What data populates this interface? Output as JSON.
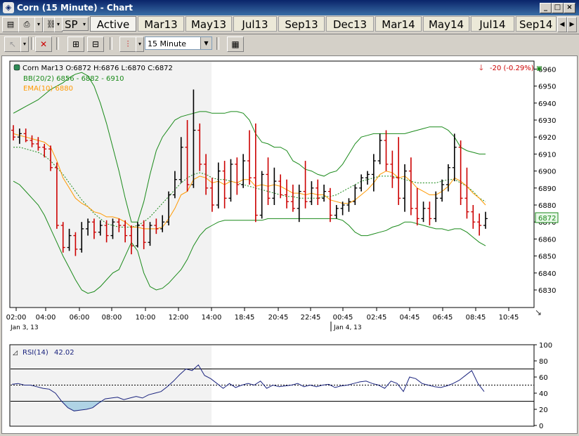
{
  "window": {
    "title": "Corn (15 Minute) - Chart"
  },
  "tabbar": {
    "symbol": "SP",
    "tabs": [
      "Active",
      "Mar13",
      "May13",
      "Jul13",
      "Sep13",
      "Dec13",
      "Mar14",
      "May14",
      "Jul14",
      "Sep14"
    ]
  },
  "toolbar": {
    "interval": "15 Minute"
  },
  "price_panel": {
    "ohlc": "Corn Mar13 O:6872 H:6876 L:6870 C:6872",
    "bb_label": "BB(20/2) 6856 - 6882 - 6910",
    "ema_label": "EMA(10) 6880",
    "change": "-20 (-0.29%)",
    "last": "6872",
    "bb_color": "#1a8a1a",
    "ema_color": "#ff9900",
    "up_color": "#000000",
    "down_color": "#cc0000"
  },
  "time_axis": {
    "ticks": [
      "02:00",
      "04:00",
      "06:00",
      "08:00",
      "10:00",
      "12:00",
      "14:00",
      "18:45",
      "20:45",
      "22:45",
      "00:45",
      "02:45",
      "04:45",
      "06:45",
      "08:45",
      "10:45"
    ],
    "dates": [
      "Jan 3, 13",
      "Jan 4, 13"
    ]
  },
  "rsi_panel": {
    "label": "RSI(14)",
    "value": "42.02"
  },
  "chart_data": [
    {
      "type": "candlestick",
      "title": "Corn Mar13",
      "y_ticks": [
        6830,
        6840,
        6850,
        6860,
        6870,
        6880,
        6890,
        6900,
        6910,
        6920,
        6930,
        6940,
        6950,
        6960
      ],
      "ylim": [
        6823,
        6967
      ],
      "bar_count": 77,
      "bars": [
        {
          "o": 6924,
          "h": 6927,
          "l": 6918,
          "c": 6920
        },
        {
          "o": 6920,
          "h": 6925,
          "l": 6916,
          "c": 6922
        },
        {
          "o": 6922,
          "h": 6925,
          "l": 6917,
          "c": 6918
        },
        {
          "o": 6918,
          "h": 6921,
          "l": 6914,
          "c": 6916
        },
        {
          "o": 6916,
          "h": 6920,
          "l": 6912,
          "c": 6914
        },
        {
          "o": 6914,
          "h": 6916,
          "l": 6908,
          "c": 6913
        },
        {
          "o": 6913,
          "h": 6915,
          "l": 6900,
          "c": 6902
        },
        {
          "o": 6902,
          "h": 6905,
          "l": 6866,
          "c": 6868
        },
        {
          "o": 6868,
          "h": 6870,
          "l": 6852,
          "c": 6855
        },
        {
          "o": 6855,
          "h": 6866,
          "l": 6853,
          "c": 6862
        },
        {
          "o": 6862,
          "h": 6864,
          "l": 6850,
          "c": 6854
        },
        {
          "o": 6854,
          "h": 6870,
          "l": 6852,
          "c": 6866
        },
        {
          "o": 6866,
          "h": 6872,
          "l": 6862,
          "c": 6870
        },
        {
          "o": 6870,
          "h": 6872,
          "l": 6860,
          "c": 6864
        },
        {
          "o": 6864,
          "h": 6871,
          "l": 6862,
          "c": 6868
        },
        {
          "o": 6868,
          "h": 6871,
          "l": 6858,
          "c": 6862
        },
        {
          "o": 6862,
          "h": 6872,
          "l": 6860,
          "c": 6870
        },
        {
          "o": 6870,
          "h": 6872,
          "l": 6864,
          "c": 6868
        },
        {
          "o": 6868,
          "h": 6871,
          "l": 6858,
          "c": 6862
        },
        {
          "o": 6862,
          "h": 6868,
          "l": 6851,
          "c": 6856
        },
        {
          "o": 6856,
          "h": 6870,
          "l": 6855,
          "c": 6868
        },
        {
          "o": 6868,
          "h": 6871,
          "l": 6854,
          "c": 6858
        },
        {
          "o": 6858,
          "h": 6870,
          "l": 6856,
          "c": 6868
        },
        {
          "o": 6868,
          "h": 6872,
          "l": 6863,
          "c": 6866
        },
        {
          "o": 6866,
          "h": 6874,
          "l": 6864,
          "c": 6870
        },
        {
          "o": 6870,
          "h": 6888,
          "l": 6868,
          "c": 6886
        },
        {
          "o": 6886,
          "h": 6900,
          "l": 6884,
          "c": 6895
        },
        {
          "o": 6895,
          "h": 6920,
          "l": 6893,
          "c": 6914
        },
        {
          "o": 6914,
          "h": 6930,
          "l": 6888,
          "c": 6892
        },
        {
          "o": 6892,
          "h": 6948,
          "l": 6890,
          "c": 6924
        },
        {
          "o": 6924,
          "h": 6928,
          "l": 6900,
          "c": 6904
        },
        {
          "o": 6904,
          "h": 6910,
          "l": 6886,
          "c": 6890
        },
        {
          "o": 6890,
          "h": 6896,
          "l": 6876,
          "c": 6880
        },
        {
          "o": 6880,
          "h": 6905,
          "l": 6878,
          "c": 6900
        },
        {
          "o": 6900,
          "h": 6906,
          "l": 6878,
          "c": 6884
        },
        {
          "o": 6884,
          "h": 6907,
          "l": 6882,
          "c": 6904
        },
        {
          "o": 6904,
          "h": 6908,
          "l": 6886,
          "c": 6892
        },
        {
          "o": 6892,
          "h": 6910,
          "l": 6890,
          "c": 6906
        },
        {
          "o": 6906,
          "h": 6924,
          "l": 6892,
          "c": 6896
        },
        {
          "o": 6896,
          "h": 6928,
          "l": 6870,
          "c": 6874
        },
        {
          "o": 6874,
          "h": 6900,
          "l": 6872,
          "c": 6898
        },
        {
          "o": 6898,
          "h": 6908,
          "l": 6880,
          "c": 6884
        },
        {
          "o": 6884,
          "h": 6902,
          "l": 6880,
          "c": 6894
        },
        {
          "o": 6894,
          "h": 6898,
          "l": 6884,
          "c": 6886
        },
        {
          "o": 6886,
          "h": 6895,
          "l": 6878,
          "c": 6882
        },
        {
          "o": 6882,
          "h": 6892,
          "l": 6876,
          "c": 6878
        },
        {
          "o": 6878,
          "h": 6892,
          "l": 6870,
          "c": 6888
        },
        {
          "o": 6888,
          "h": 6906,
          "l": 6878,
          "c": 6882
        },
        {
          "o": 6882,
          "h": 6894,
          "l": 6880,
          "c": 6890
        },
        {
          "o": 6890,
          "h": 6895,
          "l": 6880,
          "c": 6884
        },
        {
          "o": 6884,
          "h": 6892,
          "l": 6882,
          "c": 6888
        },
        {
          "o": 6888,
          "h": 6890,
          "l": 6870,
          "c": 6874
        },
        {
          "o": 6874,
          "h": 6880,
          "l": 6872,
          "c": 6878
        },
        {
          "o": 6878,
          "h": 6882,
          "l": 6874,
          "c": 6880
        },
        {
          "o": 6880,
          "h": 6884,
          "l": 6876,
          "c": 6882
        },
        {
          "o": 6882,
          "h": 6892,
          "l": 6880,
          "c": 6890
        },
        {
          "o": 6890,
          "h": 6898,
          "l": 6888,
          "c": 6896
        },
        {
          "o": 6896,
          "h": 6900,
          "l": 6892,
          "c": 6898
        },
        {
          "o": 6898,
          "h": 6910,
          "l": 6888,
          "c": 6906
        },
        {
          "o": 6906,
          "h": 6922,
          "l": 6904,
          "c": 6918
        },
        {
          "o": 6918,
          "h": 6924,
          "l": 6900,
          "c": 6904
        },
        {
          "o": 6904,
          "h": 6912,
          "l": 6890,
          "c": 6896
        },
        {
          "o": 6896,
          "h": 6920,
          "l": 6880,
          "c": 6884
        },
        {
          "o": 6884,
          "h": 6904,
          "l": 6876,
          "c": 6900
        },
        {
          "o": 6900,
          "h": 6908,
          "l": 6874,
          "c": 6878
        },
        {
          "o": 6878,
          "h": 6890,
          "l": 6868,
          "c": 6872
        },
        {
          "o": 6872,
          "h": 6882,
          "l": 6870,
          "c": 6878
        },
        {
          "o": 6878,
          "h": 6882,
          "l": 6868,
          "c": 6872
        },
        {
          "o": 6872,
          "h": 6888,
          "l": 6870,
          "c": 6884
        },
        {
          "o": 6884,
          "h": 6895,
          "l": 6882,
          "c": 6892
        },
        {
          "o": 6892,
          "h": 6904,
          "l": 6888,
          "c": 6902
        },
        {
          "o": 6902,
          "h": 6922,
          "l": 6894,
          "c": 6914
        },
        {
          "o": 6914,
          "h": 6918,
          "l": 6880,
          "c": 6884
        },
        {
          "o": 6884,
          "h": 6902,
          "l": 6872,
          "c": 6876
        },
        {
          "o": 6876,
          "h": 6880,
          "l": 6866,
          "c": 6870
        },
        {
          "o": 6870,
          "h": 6875,
          "l": 6862,
          "c": 6868
        },
        {
          "o": 6868,
          "h": 6876,
          "l": 6866,
          "c": 6872
        }
      ],
      "bb_upper": [
        6934,
        6936,
        6938,
        6940,
        6942,
        6945,
        6948,
        6950,
        6952,
        6955,
        6957,
        6958,
        6956,
        6950,
        6940,
        6928,
        6914,
        6900,
        6884,
        6870,
        6870,
        6882,
        6898,
        6912,
        6920,
        6925,
        6930,
        6932,
        6933,
        6934,
        6935,
        6935,
        6934,
        6934,
        6934,
        6935,
        6935,
        6934,
        6930,
        6922,
        6917,
        6916,
        6914,
        6914,
        6912,
        6906,
        6904,
        6901,
        6900,
        6898,
        6897,
        6899,
        6900,
        6904,
        6910,
        6916,
        6920,
        6921,
        6922,
        6922,
        6922,
        6922,
        6922,
        6922,
        6923,
        6924,
        6925,
        6926,
        6926,
        6926,
        6924,
        6920,
        6914,
        6912,
        6911,
        6910,
        6910
      ],
      "bb_mid": [
        6914,
        6914,
        6913,
        6912,
        6911,
        6909,
        6906,
        6902,
        6898,
        6893,
        6888,
        6883,
        6879,
        6875,
        6872,
        6869,
        6868,
        6867,
        6867,
        6867,
        6868,
        6870,
        6873,
        6877,
        6881,
        6885,
        6889,
        6893,
        6896,
        6898,
        6899,
        6898,
        6896,
        6895,
        6895,
        6894,
        6893,
        6892,
        6891,
        6890,
        6889,
        6888,
        6887,
        6886,
        6885,
        6885,
        6884,
        6884,
        6884,
        6884,
        6885,
        6885,
        6886,
        6888,
        6890,
        6892,
        6894,
        6895,
        6896,
        6897,
        6897,
        6897,
        6896,
        6895,
        6894,
        6893,
        6893,
        6893,
        6893,
        6894,
        6895,
        6895,
        6893,
        6891,
        6888,
        6884,
        6882
      ],
      "bb_lower": [
        6894,
        6892,
        6888,
        6884,
        6880,
        6874,
        6866,
        6858,
        6850,
        6843,
        6836,
        6830,
        6828,
        6829,
        6832,
        6836,
        6840,
        6842,
        6850,
        6858,
        6853,
        6840,
        6832,
        6830,
        6831,
        6834,
        6838,
        6842,
        6848,
        6856,
        6862,
        6866,
        6868,
        6870,
        6871,
        6871,
        6871,
        6871,
        6871,
        6871,
        6871,
        6872,
        6872,
        6872,
        6872,
        6872,
        6872,
        6872,
        6872,
        6872,
        6872,
        6872,
        6872,
        6871,
        6868,
        6864,
        6862,
        6862,
        6863,
        6864,
        6865,
        6867,
        6868,
        6870,
        6870,
        6869,
        6868,
        6867,
        6866,
        6866,
        6865,
        6866,
        6866,
        6864,
        6861,
        6858,
        6856
      ],
      "ema": [
        6922,
        6921,
        6920,
        6919,
        6918,
        6917,
        6914,
        6906,
        6896,
        6890,
        6884,
        6881,
        6879,
        6876,
        6875,
        6873,
        6873,
        6872,
        6870,
        6867,
        6867,
        6866,
        6866,
        6866,
        6867,
        6872,
        6878,
        6886,
        6888,
        6895,
        6897,
        6896,
        6893,
        6894,
        6892,
        6894,
        6893,
        6895,
        6895,
        6891,
        6892,
        6891,
        6892,
        6891,
        6889,
        6887,
        6887,
        6886,
        6887,
        6886,
        6886,
        6883,
        6882,
        6881,
        6881,
        6883,
        6886,
        6889,
        6893,
        6898,
        6900,
        6899,
        6896,
        6897,
        6894,
        6890,
        6888,
        6886,
        6886,
        6888,
        6891,
        6896,
        6894,
        6891,
        6887,
        6884,
        6880
      ]
    },
    {
      "type": "line",
      "title": "RSI(14)",
      "y_ticks": [
        0,
        20,
        40,
        60,
        80,
        100
      ],
      "ylim": [
        0,
        100
      ],
      "reference_lines": [
        30,
        50,
        70
      ],
      "values": [
        51,
        52,
        50,
        50,
        48,
        46,
        45,
        40,
        30,
        22,
        18,
        19,
        20,
        22,
        28,
        33,
        34,
        35,
        32,
        34,
        36,
        34,
        38,
        40,
        42,
        48,
        55,
        63,
        70,
        68,
        75,
        62,
        58,
        52,
        46,
        52,
        47,
        50,
        52,
        50,
        55,
        46,
        50,
        48,
        49,
        50,
        52,
        48,
        50,
        48,
        50,
        51,
        47,
        49,
        50,
        52,
        54,
        55,
        52,
        50,
        46,
        55,
        52,
        42,
        60,
        58,
        52,
        50,
        48,
        47,
        49,
        52,
        56,
        62,
        68,
        52,
        42
      ]
    }
  ]
}
